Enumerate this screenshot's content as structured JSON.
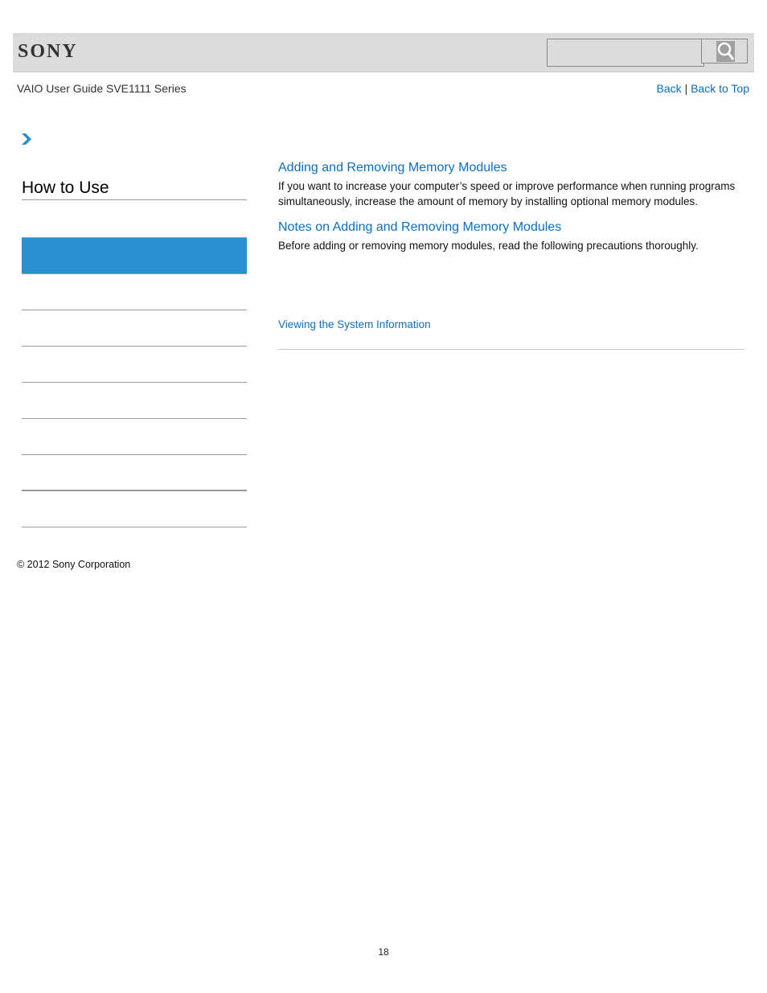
{
  "header": {
    "logo": "SONY",
    "search": {
      "value": "",
      "placeholder": ""
    },
    "search_icon": "search-icon"
  },
  "subheader": {
    "guide_title": "VAIO User Guide SVE1111 Series",
    "back_label": "Back",
    "separator": "|",
    "back_to_top_label": "Back to Top"
  },
  "breadcrumb": {
    "icon": "chevron-right-icon"
  },
  "sidebar": {
    "title": "How to Use",
    "items": [
      {
        "label": "",
        "active": true
      },
      {
        "label": ""
      },
      {
        "label": ""
      },
      {
        "label": ""
      },
      {
        "label": ""
      },
      {
        "label": ""
      },
      {
        "label": ""
      },
      {
        "label": ""
      }
    ]
  },
  "main": {
    "topics": [
      {
        "title": "Adding and Removing Memory Modules",
        "description": "If you want to increase your computer’s speed or improve performance when running programs simultaneously, increase the amount of memory by installing optional memory modules."
      },
      {
        "title": "Notes on Adding and Removing Memory Modules",
        "description": "Before adding or removing memory modules, read the following precautions thoroughly."
      }
    ],
    "related_link": "Viewing the System Information"
  },
  "footer": {
    "copyright": "© 2012 Sony Corporation",
    "page_number": "18"
  },
  "colors": {
    "accent": "#2a8fce",
    "link": "#0a6fc2",
    "header_bg": "#dcdcdc"
  }
}
